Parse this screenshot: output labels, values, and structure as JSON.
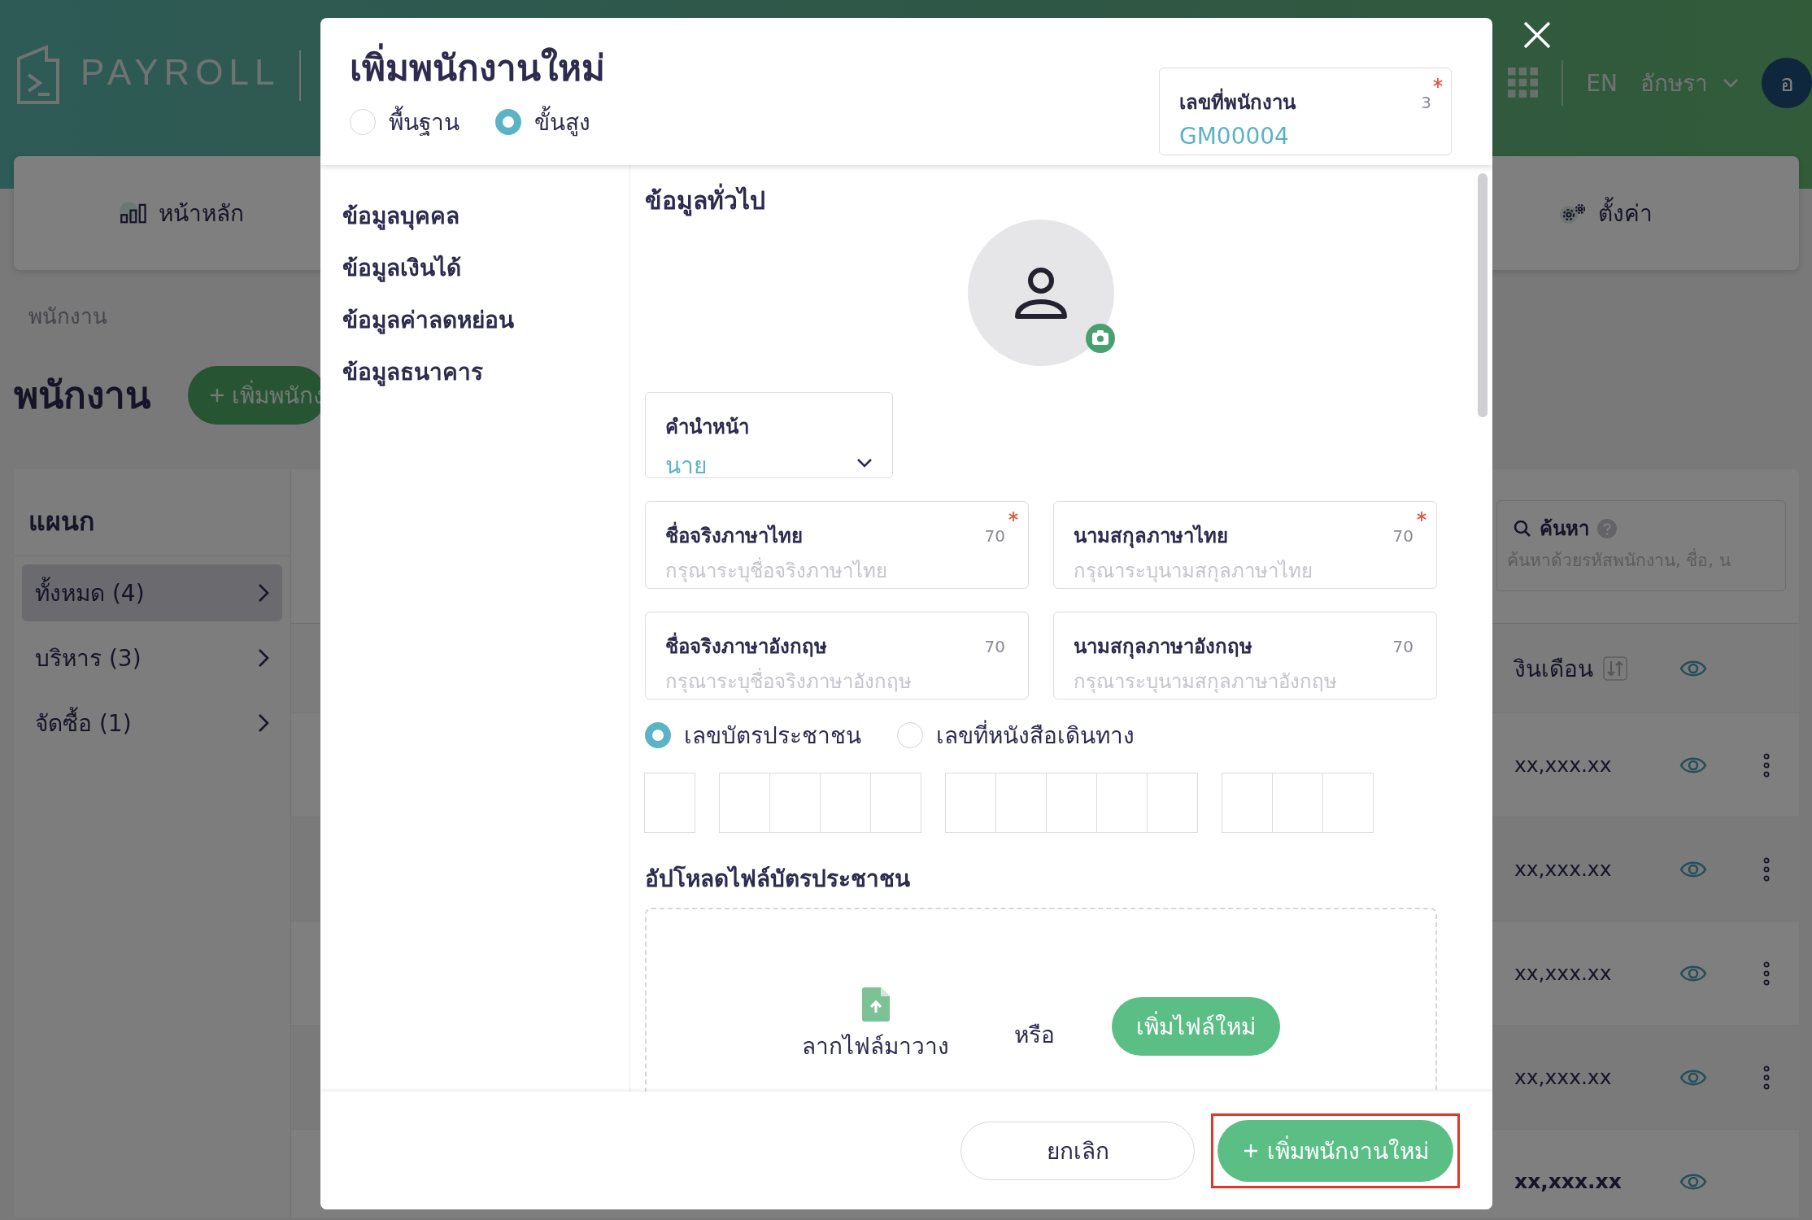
{
  "header": {
    "logo_text": "PAYROLL",
    "language": "EN",
    "user_name": "อักษรา",
    "avatar_initial": "อ"
  },
  "nav": [
    {
      "label": "หน้าหลัก",
      "kind": "chart"
    },
    {
      "label": "ตั้งค่า",
      "kind": "gears"
    }
  ],
  "breadcrumb": "พนักงาน",
  "page_title": "พนักงาน",
  "add_button": "เพิ่มพนักง",
  "departments": {
    "title": "แผนก",
    "items": [
      {
        "label": "ทั้งหมด (4)",
        "selected": true
      },
      {
        "label": "บริหาร (3)",
        "selected": false
      },
      {
        "label": "จัดซื้อ (1)",
        "selected": false
      }
    ]
  },
  "table": {
    "search": {
      "label": "ค้นหา",
      "placeholder": "ค้นหาด้วยรหัสพนักงาน, ชื่อ, น"
    },
    "salary_header": "งินเดือน",
    "rows": [
      {
        "salary": "xx,xxx.xx",
        "kind": "employee"
      },
      {
        "salary": "xx,xxx.xx",
        "kind": "employee"
      },
      {
        "salary": "xx,xxx.xx",
        "kind": "employee"
      },
      {
        "salary": "xx,xxx.xx",
        "kind": "employee"
      },
      {
        "salary": "xx,xxx.xx",
        "kind": "total"
      }
    ]
  },
  "modal": {
    "title": "เพิ่มพนักงานใหม่",
    "modes": [
      {
        "label": "พื้นฐาน",
        "selected": false
      },
      {
        "label": "ขั้นสูง",
        "selected": true
      }
    ],
    "employee_no": {
      "label": "เลขที่พนักงาน",
      "counter": "3",
      "required": true,
      "value": "GM00004"
    },
    "sections": [
      "ข้อมูลบุคคล",
      "ข้อมูลเงินได้",
      "ข้อมูลค่าลดหย่อน",
      "ข้อมูลธนาคาร"
    ],
    "section_title": "ข้อมูลทั่วไป",
    "prefix": {
      "label": "คำนำหน้า",
      "value": "นาย"
    },
    "name_fields": [
      {
        "label": "ชื่อจริงภาษาไทย",
        "counter": "70",
        "required": true,
        "placeholder": "กรุณาระบุชื่อจริงภาษาไทย"
      },
      {
        "label": "นามสกุลภาษาไทย",
        "counter": "70",
        "required": true,
        "placeholder": "กรุณาระบุนามสกุลภาษาไทย"
      },
      {
        "label": "ชื่อจริงภาษาอังกฤษ",
        "counter": "70",
        "required": false,
        "placeholder": "กรุณาระบุชื่อจริงภาษาอังกฤษ"
      },
      {
        "label": "นามสกุลภาษาอังกฤษ",
        "counter": "70",
        "required": false,
        "placeholder": "กรุณาระบุนามสกุลภาษาอังกฤษ"
      }
    ],
    "id_types": [
      {
        "label": "เลขบัตรประชาชน",
        "selected": true
      },
      {
        "label": "เลขที่หนังสือเดินทาง",
        "selected": false
      }
    ],
    "upload": {
      "title": "อัปโหลดไฟล์บัตรประชาชน",
      "drop_text": "ลากไฟล์มาวาง",
      "or_text": "หรือ",
      "button": "เพิ่มไฟล์ใหม่"
    },
    "cancel_button": "ยกเลิก",
    "submit_button": "เพิ่มพนักงานใหม่",
    "submit_highlighted": true
  }
}
